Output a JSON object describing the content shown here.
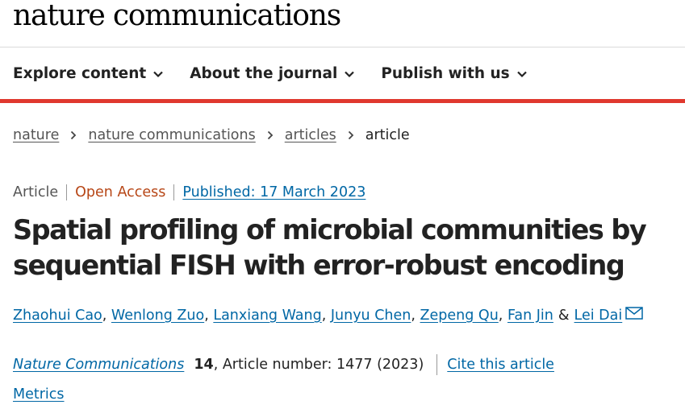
{
  "header": {
    "logo": "nature communications"
  },
  "nav": {
    "items": [
      {
        "label": "Explore content",
        "icon": "chevron-down-icon"
      },
      {
        "label": "About the journal",
        "icon": "chevron-down-icon"
      },
      {
        "label": "Publish with us",
        "icon": "chevron-down-icon"
      }
    ],
    "accent_color": "#e0382e"
  },
  "breadcrumb": {
    "items": [
      "nature",
      "nature communications",
      "articles"
    ],
    "current": "article"
  },
  "article": {
    "type": "Article",
    "access": "Open Access",
    "published": "Published: 17 March 2023",
    "title": "Spatial profiling of microbial communities by sequential FISH with error-robust encoding",
    "authors": [
      "Zhaohui Cao",
      "Wenlong Zuo",
      "Lanxiang Wang",
      "Junyu Chen",
      "Zepeng Qu",
      "Fan Jin",
      "Lei Dai"
    ],
    "author_joiner": "&",
    "journal": "Nature Communications",
    "volume": "14",
    "article_number": ", Article number: 1477 (2023)",
    "cite_label": "Cite this article",
    "metrics_label": "Metrics",
    "link_color": "#0067a5",
    "open_access_color": "#b74616"
  }
}
